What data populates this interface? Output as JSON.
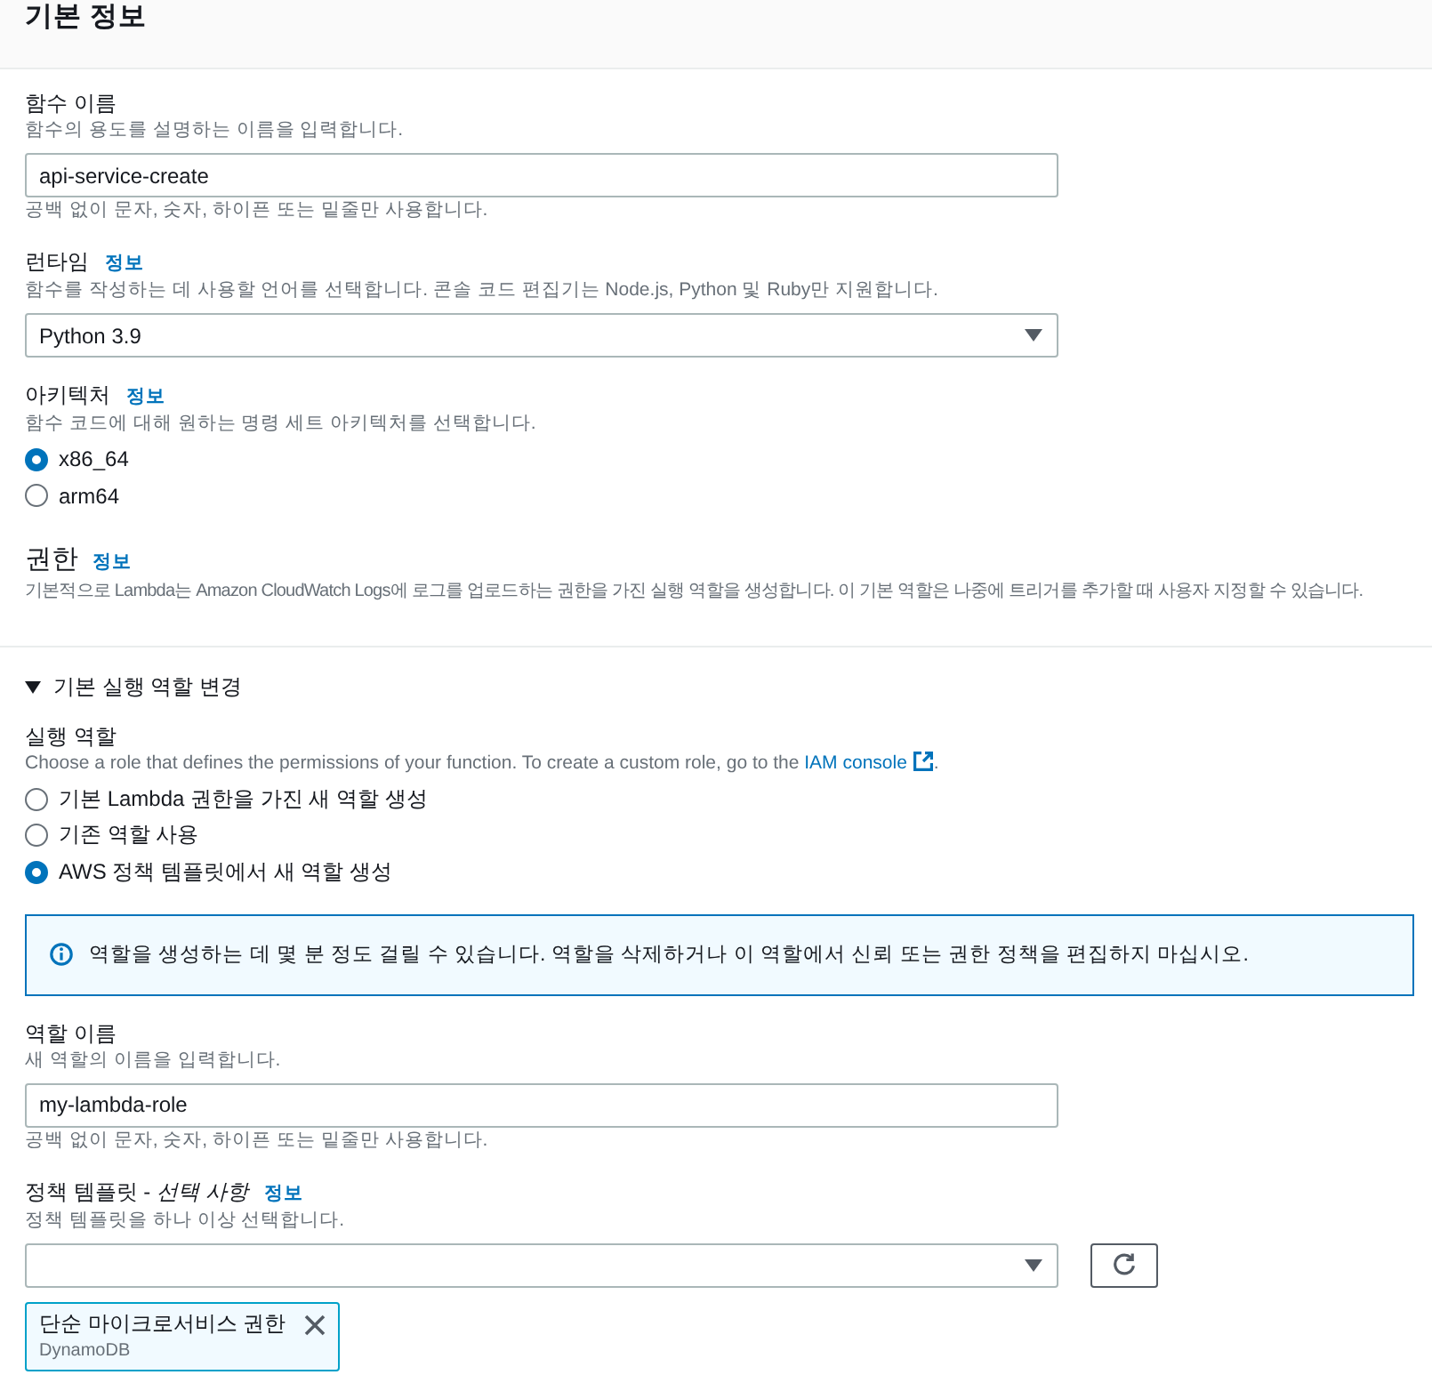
{
  "header": {
    "title": "기본 정보"
  },
  "fields": [
    {
      "kind": "text_input",
      "label": "함수 이름",
      "description": "함수의 용도를 설명하는 이름을 입력합니다.",
      "value": "api-service-create",
      "constraint": "공백 없이 문자, 숫자, 하이픈 또는 밑줄만 사용합니다."
    },
    {
      "kind": "select",
      "label": "런타임",
      "info": "정보",
      "description": "함수를 작성하는 데 사용할 언어를 선택합니다. 콘솔 코드 편집기는 Node.js, Python 및 Ruby만 지원합니다.",
      "value": "Python 3.9"
    },
    {
      "kind": "radio_group",
      "label": "아키텍처",
      "info": "정보",
      "description": "함수 코드에 대해 원하는 명령 세트 아키텍처를 선택합니다.",
      "options": [
        {
          "label": "x86_64",
          "selected": true
        },
        {
          "label": "arm64",
          "selected": false
        }
      ]
    }
  ],
  "permissions": {
    "title": "권한",
    "info": "정보",
    "description": "기본적으로 Lambda는 Amazon CloudWatch Logs에 로그를 업로드하는 권한을 가진 실행 역할을 생성합니다. 이 기본 역할은 나중에 트리거를 추가할 때 사용자 지정할 수 있습니다."
  },
  "execution_role": {
    "title": "기본 실행 역할 변경",
    "expanded": true,
    "fields": [
      {
        "kind": "radio_group",
        "label": "실행 역할",
        "description": {
          "text": "Choose a role that defines the permissions of your function. To create a custom role, go to the ",
          "link": "IAM console",
          "after": "."
        },
        "options": [
          {
            "label": "기본 Lambda 권한을 가진 새 역할 생성",
            "selected": false
          },
          {
            "label": "기존 역할 사용",
            "selected": false
          },
          {
            "label": "AWS 정책 템플릿에서 새 역할 생성",
            "selected": true
          }
        ]
      },
      {
        "kind": "alert",
        "text": "역할을 생성하는 데 몇 분 정도 걸릴 수 있습니다. 역할을 삭제하거나 이 역할에서 신뢰 또는 권한 정책을 편집하지 마십시오."
      },
      {
        "kind": "text_input",
        "label": "역할 이름",
        "description": "새 역할의 이름을 입력합니다.",
        "value": "my-lambda-role",
        "constraint": "공백 없이 문자, 숫자, 하이픈 또는 밑줄만 사용합니다."
      },
      {
        "kind": "multiselect",
        "label": "정책 템플릿 - *선택 사항*",
        "info": "정보",
        "description": "정책 템플릿을 하나 이상 선택합니다.",
        "tokens": [
          {
            "label": "단순 마이크로서비스 권한",
            "sublabel": "DynamoDB"
          }
        ]
      }
    ]
  }
}
